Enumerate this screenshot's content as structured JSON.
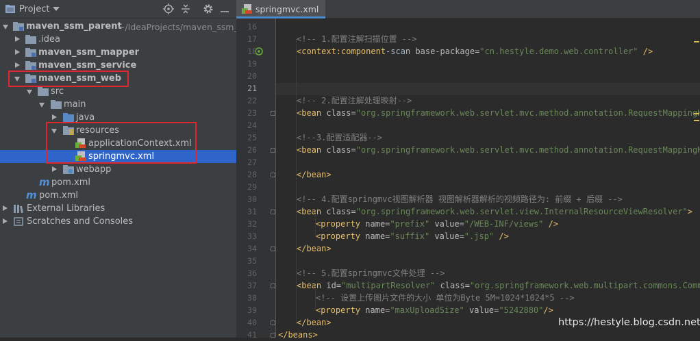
{
  "project_panel": {
    "title": "Project",
    "tree": [
      {
        "label": "maven_ssm_parent",
        "path": "~/IdeaProjects/maven_ssm_p"
      },
      {
        "label": ".idea"
      },
      {
        "label": "maven_ssm_mapper"
      },
      {
        "label": "maven_ssm_service"
      },
      {
        "label": "maven_ssm_web"
      },
      {
        "label": "src"
      },
      {
        "label": "main"
      },
      {
        "label": "java"
      },
      {
        "label": "resources"
      },
      {
        "label": "applicationContext.xml"
      },
      {
        "label": "springmvc.xml",
        "selected": true
      },
      {
        "label": "webapp"
      },
      {
        "label": "pom.xml"
      },
      {
        "label": "pom.xml"
      },
      {
        "label": "External Libraries"
      },
      {
        "label": "Scratches and Consoles"
      }
    ]
  },
  "editor": {
    "tab_label": "springmvc.xml",
    "current_line": "21",
    "lines": [
      {
        "n": "16",
        "t": ""
      },
      {
        "n": "17",
        "t": "<!-- 1.配置注解扫描位置 -->"
      },
      {
        "n": "18",
        "t": "<context:component-scan base-package=\"cn.hestyle.demo.web.controller\" />"
      },
      {
        "n": "19",
        "t": ""
      },
      {
        "n": "20",
        "t": ""
      },
      {
        "n": "21",
        "t": ""
      },
      {
        "n": "22",
        "t": "<!-- 2.配置注解处理映射-->"
      },
      {
        "n": "23",
        "t": "<bean class=\"org.springframework.web.servlet.mvc.method.annotation.RequestMappingHan"
      },
      {
        "n": "24",
        "t": ""
      },
      {
        "n": "25",
        "t": "<!--3.配置适配器-->"
      },
      {
        "n": "26",
        "t": "<bean class=\"org.springframework.web.servlet.mvc.method.annotation.RequestMappingHan"
      },
      {
        "n": "27",
        "t": ""
      },
      {
        "n": "28",
        "t": "</bean>"
      },
      {
        "n": "29",
        "t": ""
      },
      {
        "n": "30",
        "t": "<!-- 4.配置springmvc视图解析器 视图解析器解析的视频路径为: 前缀 + 后缀 -->"
      },
      {
        "n": "31",
        "t": "<bean class=\"org.springframework.web.servlet.view.InternalResourceViewResolver\">"
      },
      {
        "n": "32",
        "t": "<property name=\"prefix\" value=\"/WEB-INF/views\" />"
      },
      {
        "n": "33",
        "t": "<property name=\"suffix\" value=\".jsp\" />"
      },
      {
        "n": "34",
        "t": "</bean>"
      },
      {
        "n": "35",
        "t": ""
      },
      {
        "n": "36",
        "t": "<!-- 5.配置springmvc文件处理 -->"
      },
      {
        "n": "37",
        "t": "<bean id=\"multipartResolver\" class=\"org.springframework.web.multipart.commons.Common"
      },
      {
        "n": "38",
        "t": "<!-- 设置上传图片文件的大小 单位为Byte 5M=1024*1024*5 -->"
      },
      {
        "n": "39",
        "t": "<property name=\"maxUploadSize\" value=\"5242880\"/>"
      },
      {
        "n": "40",
        "t": "</bean>"
      },
      {
        "n": "41",
        "t": "</beans>"
      }
    ]
  },
  "watermark": "https://hestyle.blog.csdn.net",
  "colors": {
    "selection": "#2f65ca",
    "highlight_box": "#e0272e",
    "tag": "#e8bf6a",
    "string": "#6a8759",
    "comment": "#808080"
  }
}
